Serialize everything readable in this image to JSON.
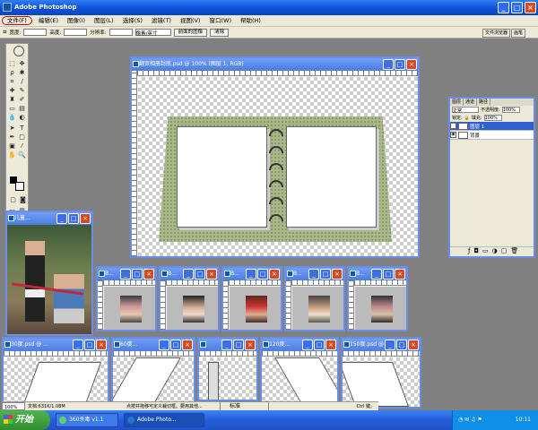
{
  "app": {
    "title": "Adobe Photoshop"
  },
  "menu": [
    "文件(F)",
    "编辑(E)",
    "图像(I)",
    "图层(L)",
    "选择(S)",
    "滤镜(T)",
    "视图(V)",
    "窗口(W)",
    "帮助(H)"
  ],
  "options": {
    "width_label": "宽度:",
    "height_label": "高度:",
    "res_label": "分辨率:",
    "unit": "像素/英寸",
    "front_image": "前面的图像",
    "clear": "清除"
  },
  "tabwell": [
    "文件浏览器",
    "画笔"
  ],
  "main_doc": {
    "title": "翻页相册封底.psd @ 100% (图层 1, RGB)"
  },
  "photo_doc": {
    "title": "儿童..."
  },
  "small_docs": [
    "B...",
    "B...",
    "B...",
    "B...",
    "B..."
  ],
  "bottom_docs": [
    "30度.psd @ ...",
    "60度...",
    "",
    "120度...",
    "150度.psd @ ..."
  ],
  "layers_panel": {
    "tabs": [
      "图层",
      "通道",
      "路径"
    ],
    "mode": "正常",
    "opacity_label": "不透明度:",
    "opacity": "100%",
    "lock_label": "锁定:",
    "fill_label": "填充:",
    "fill": "100%",
    "layers": [
      {
        "name": "图层 1",
        "selected": true
      },
      {
        "name": "背景",
        "selected": false
      }
    ]
  },
  "status": {
    "zoom": "100%",
    "doc": "文档:631K/1.08M",
    "msg": "点按并拖移可定义裁切框。要用其他...",
    "msg_end": "Ctrl 键。"
  },
  "taskbar": {
    "start": "开始",
    "items": [
      "360杀毒 v1.1",
      "Adobe Photo..."
    ],
    "mini": "标准",
    "clock": "10:11"
  }
}
